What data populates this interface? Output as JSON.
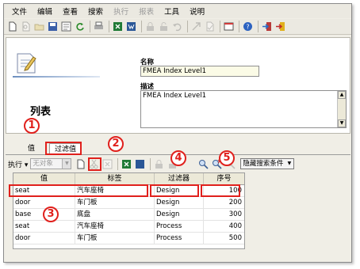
{
  "menubar": {
    "items": [
      {
        "label": "文件",
        "enabled": true
      },
      {
        "label": "编辑",
        "enabled": true
      },
      {
        "label": "查看",
        "enabled": true
      },
      {
        "label": "搜索",
        "enabled": true
      },
      {
        "label": "执行",
        "enabled": false
      },
      {
        "label": "报表",
        "enabled": false
      },
      {
        "label": "工具",
        "enabled": true
      },
      {
        "label": "说明",
        "enabled": true
      }
    ]
  },
  "header": {
    "page_title": "列表",
    "name_label": "名称",
    "name_value": "FMEA Index Level1",
    "desc_label": "描述",
    "desc_value": "FMEA Index Level1"
  },
  "tabs": {
    "value_label": "值",
    "filter_label": "过滤值"
  },
  "toolbar2": {
    "exec_label": "执行",
    "object_placeholder": "无对象",
    "hidden_search": "隐藏搜索条件"
  },
  "grid": {
    "columns": [
      "值",
      "标签",
      "过滤器",
      "序号"
    ],
    "rows": [
      {
        "value": "seat",
        "label": "汽车座椅",
        "filter": "Design",
        "seq": "100"
      },
      {
        "value": "door",
        "label": "车门板",
        "filter": "Design",
        "seq": "200"
      },
      {
        "value": "base",
        "label": "底盘",
        "filter": "Design",
        "seq": "300"
      },
      {
        "value": "seat",
        "label": "汽车座椅",
        "filter": "Process",
        "seq": "400"
      },
      {
        "value": "door",
        "label": "车门板",
        "filter": "Process",
        "seq": "500"
      }
    ]
  },
  "annotations": [
    "1",
    "2",
    "3",
    "4",
    "5"
  ],
  "colors": {
    "annotation": "#e0201c",
    "name_field_bg": "#fbfbe6"
  }
}
